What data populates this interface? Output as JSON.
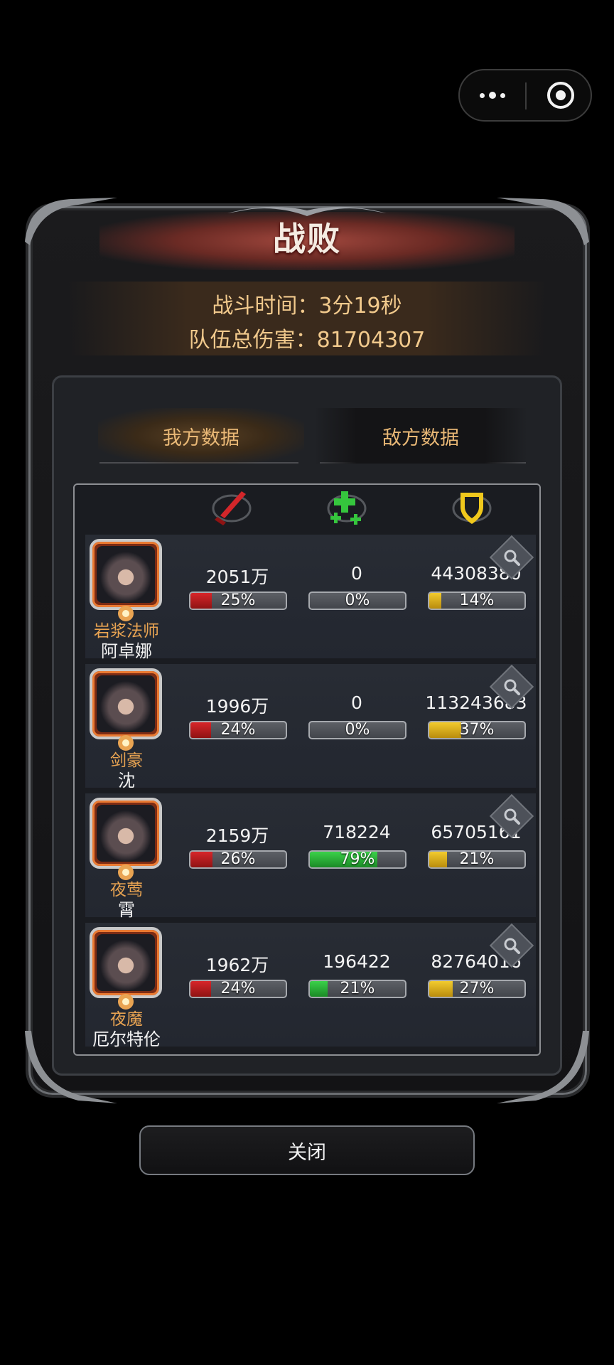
{
  "capsule": {
    "more_icon": "more-dots-icon",
    "close_icon": "target-circle-icon"
  },
  "title": "战败",
  "info": {
    "battle_time": "战斗时间：3分19秒",
    "team_damage": "队伍总伤害：81704307"
  },
  "tabs": [
    {
      "label": "我方数据",
      "active": true
    },
    {
      "label": "敌方数据",
      "active": false
    }
  ],
  "columns": [
    {
      "icon": "sword-damage-icon",
      "color": "#d3262a"
    },
    {
      "icon": "green-cross-heal-icon",
      "color": "#35c63d"
    },
    {
      "icon": "shield-tank-icon",
      "color": "#f0c81c"
    }
  ],
  "heroes": [
    {
      "class": "岩浆法师",
      "name": "阿卓娜",
      "damage": "2051万",
      "damage_pct_label": "25%",
      "damage_pct": 25,
      "heal": "0",
      "heal_pct_label": "0%",
      "heal_pct": 0,
      "taken": "44308380",
      "taken_pct_label": "14%",
      "taken_pct": 14
    },
    {
      "class": "剑豪",
      "name": "沈",
      "damage": "1996万",
      "damage_pct_label": "24%",
      "damage_pct": 24,
      "heal": "0",
      "heal_pct_label": "0%",
      "heal_pct": 0,
      "taken": "113243683",
      "taken_pct_label": "37%",
      "taken_pct": 37
    },
    {
      "class": "夜莺",
      "name": "霄",
      "damage": "2159万",
      "damage_pct_label": "26%",
      "damage_pct": 26,
      "heal": "718224",
      "heal_pct_label": "79%",
      "heal_pct": 79,
      "taken": "65705161",
      "taken_pct_label": "21%",
      "taken_pct": 21
    },
    {
      "class": "夜魔",
      "name": "厄尔特伦",
      "damage": "1962万",
      "damage_pct_label": "24%",
      "damage_pct": 24,
      "heal": "196422",
      "heal_pct_label": "21%",
      "heal_pct": 21,
      "taken": "82764016",
      "taken_pct_label": "27%",
      "taken_pct": 27
    }
  ],
  "close_button": "关闭"
}
